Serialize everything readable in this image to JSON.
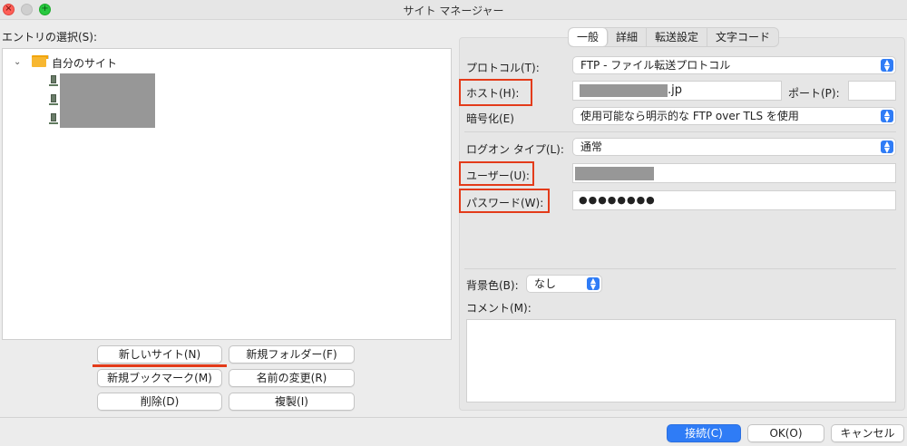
{
  "window": {
    "title": "サイト マネージャー"
  },
  "entries": {
    "label": "エントリの選択(S):",
    "root": "自分のサイト",
    "sites": [
      "",
      "",
      ""
    ]
  },
  "buttons": {
    "new_site": "新しいサイト(N)",
    "new_folder": "新規フォルダー(F)",
    "new_bookmark": "新規ブックマーク(M)",
    "rename": "名前の変更(R)",
    "delete": "削除(D)",
    "duplicate": "複製(I)",
    "connect": "接続(C)",
    "ok": "OK(O)",
    "cancel": "キャンセル"
  },
  "tabs": [
    "一般",
    "詳細",
    "転送設定",
    "文字コード"
  ],
  "form": {
    "protocol_label": "プロトコル(T):",
    "protocol_value": "FTP - ファイル転送プロトコル",
    "host_label": "ホスト(H):",
    "host_value_suffix": ".jp",
    "port_label": "ポート(P):",
    "port_value": "",
    "encryption_label": "暗号化(E)",
    "encryption_value": "使用可能なら明示的な FTP over TLS を使用",
    "logon_label": "ログオン タイプ(L):",
    "logon_value": "通常",
    "user_label": "ユーザー(U):",
    "password_label": "パスワード(W):",
    "password_value": "●●●●●●●●",
    "bgcolor_label": "背景色(B):",
    "bgcolor_value": "なし",
    "comment_label": "コメント(M):"
  },
  "colors": {
    "accent": "#2f7cf6",
    "highlight_red": "#e33b1a",
    "redaction_gray": "#979797"
  },
  "icons": {
    "close": "close-icon",
    "minimize": "minimize-icon",
    "maximize": "maximize-icon",
    "folder": "folder-icon",
    "server": "server-icon",
    "chevron": "chevron-down-icon",
    "select_arrows": "updown-arrows-icon"
  }
}
